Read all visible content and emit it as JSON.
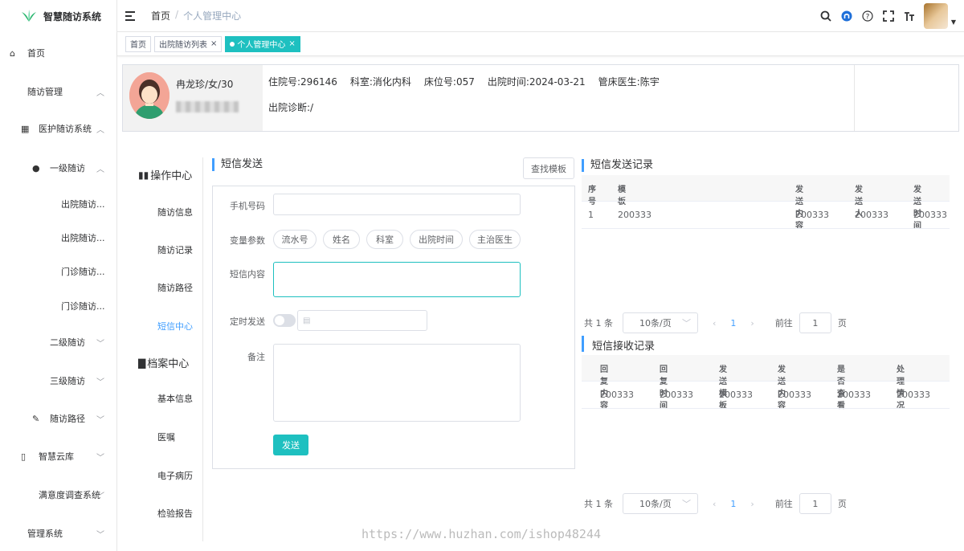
{
  "app": {
    "title": "智慧随访系统"
  },
  "sidebar": {
    "items": [
      {
        "label": "首页",
        "icon": "dashboard-icon"
      },
      {
        "label": "随访管理",
        "arrow": "^"
      },
      {
        "label": "医护随访系统",
        "icon": "grid-icon",
        "arrow": "^"
      },
      {
        "label": "一级随访",
        "icon": "user-icon",
        "arrow": "^"
      },
      {
        "label": "出院随访..."
      },
      {
        "label": "出院随访..."
      },
      {
        "label": "门诊随访..."
      },
      {
        "label": "门诊随访..."
      },
      {
        "label": "二级随访",
        "arrow": "v"
      },
      {
        "label": "三级随访",
        "arrow": "v"
      },
      {
        "label": "随访路径",
        "icon": "edit-icon",
        "arrow": "v"
      },
      {
        "label": "智慧云库",
        "icon": "book-icon",
        "arrow": "v"
      },
      {
        "label": "满意度调查系统",
        "arrow": "v"
      },
      {
        "label": "管理系统",
        "arrow": "v"
      }
    ]
  },
  "header": {
    "breadcrumb": [
      "首页",
      "个人管理中心"
    ],
    "separator": "/"
  },
  "tags": [
    {
      "label": "首页",
      "closable": false
    },
    {
      "label": "出院随访列表",
      "closable": true
    },
    {
      "label": "个人管理中心",
      "closable": true,
      "active": true
    }
  ],
  "patient": {
    "name_line": "冉龙珍/女/30",
    "admission_no": "住院号:296146",
    "department": "科室:消化内科",
    "bed_no": "床位号:057",
    "discharge_time": "出院时间:2024-03-21",
    "doctor": "管床医生:陈宇",
    "diagnosis": "出院诊断:/"
  },
  "left_nav": {
    "op_center": "操作中心",
    "op_items": [
      "随访信息",
      "随访记录",
      "随访路径",
      "短信中心"
    ],
    "archive_center": "档案中心",
    "archive_items": [
      "基本信息",
      "医嘱",
      "电子病历",
      "检验报告"
    ]
  },
  "sms_form": {
    "title": "短信发送",
    "find_template": "查找模板",
    "phone_label": "手机号码",
    "phone_value": "",
    "vars_label": "变量参数",
    "vars": [
      "流水号",
      "姓名",
      "科室",
      "出院时间",
      "主治医生"
    ],
    "content_label": "短信内容",
    "content_value": "",
    "schedule_label": "定时发送",
    "remark_label": "备注",
    "send": "发送"
  },
  "send_records": {
    "title": "短信发送记录",
    "columns": [
      "序号",
      "模板",
      "发送内容",
      "发送人",
      "发送时间"
    ],
    "rows": [
      [
        "1",
        "200333",
        "200333",
        "200333",
        "200333"
      ]
    ],
    "pager": {
      "total": "共 1 条",
      "size": "10条/页",
      "page": "1",
      "goto": "前往",
      "goto_value": "1",
      "unit": "页"
    }
  },
  "recv_records": {
    "title": "短信接收记录",
    "columns": [
      "回复内容",
      "回复时间",
      "发送模板",
      "发送内容",
      "是否查看",
      "处理情况"
    ],
    "rows": [
      [
        "200333",
        "200333",
        "200333",
        "200333",
        "200333",
        "200333"
      ]
    ],
    "pager": {
      "total": "共 1 条",
      "size": "10条/页",
      "page": "1",
      "goto": "前往",
      "goto_value": "1",
      "unit": "页"
    }
  },
  "watermark": "https://www.huzhan.com/ishop48244",
  "colors": {
    "accent": "#1ec0c0",
    "link": "#409eff"
  }
}
